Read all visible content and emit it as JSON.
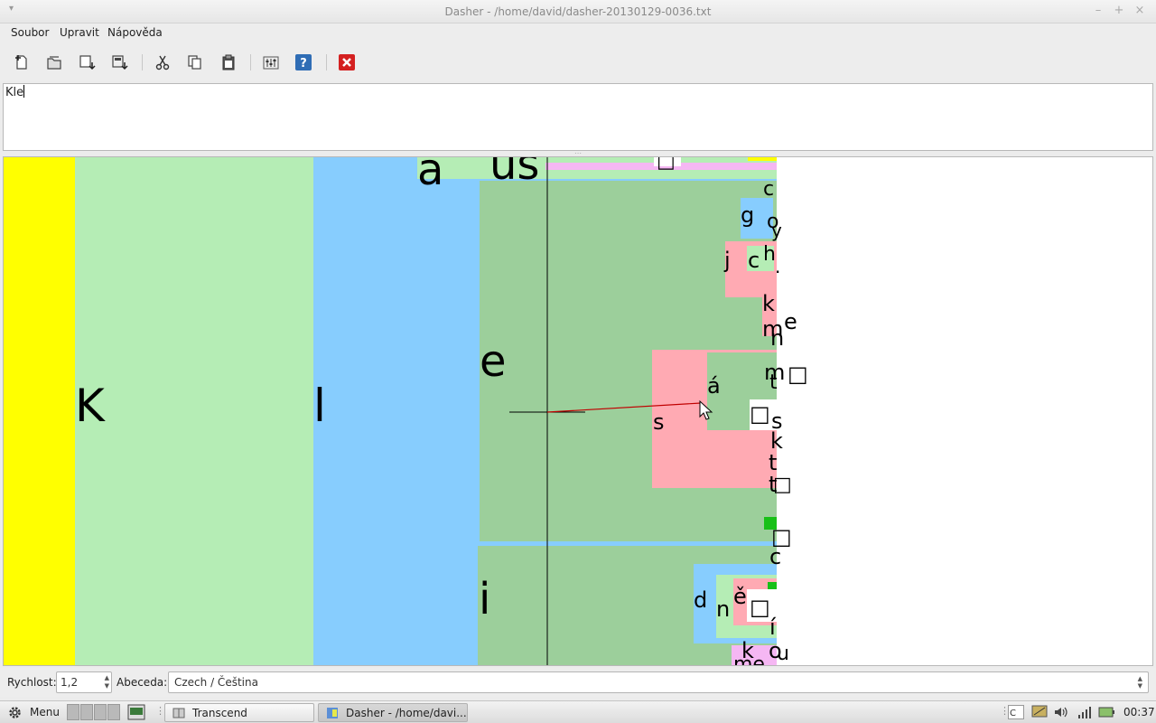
{
  "window": {
    "title": "Dasher - /home/david/dasher-20130129-0036.txt"
  },
  "menubar": {
    "items": [
      "Soubor",
      "Upravit",
      "Nápověda"
    ]
  },
  "toolbar": {
    "icons": [
      "new-file-icon",
      "open-file-icon",
      "save-file-icon",
      "save-as-icon",
      "cut-icon",
      "copy-icon",
      "paste-icon",
      "preferences-icon",
      "help-icon",
      "quit-icon"
    ],
    "help_glyph": "?",
    "colors": {
      "help_bg": "#2f6db5",
      "quit_bg": "#d42020"
    }
  },
  "editor": {
    "text": "Kle"
  },
  "canvas": {
    "colors": {
      "yellow": "#ffff00",
      "light_green": "#b5edb5",
      "light_blue": "#87cdfe",
      "mid_green": "#9ccf9b",
      "pink": "#ffaab3",
      "magenta_light": "#f5b7f3",
      "green_bright": "#18c018",
      "crosshair": "#000000",
      "pointer_line": "#c00000"
    },
    "letters": {
      "K": "K",
      "l": "l",
      "a": "a",
      "us": "us",
      "e": "e",
      "i": "i",
      "s": "s",
      "aacute": "á",
      "c1": "c",
      "g": "g",
      "o": "o",
      "y": "y",
      "j": "j",
      "c2": "c",
      "h": "h",
      "dot": ".",
      "k1": "k",
      "m1": "m",
      "e2": "e",
      "n1": "n",
      "m2": "m",
      "t1": "t",
      "s2": "s",
      "k2": "k",
      "t2": "t",
      "t3": "t",
      "c3": "c",
      "d": "d",
      "n2": "n",
      "ecaron": "ě",
      "iacute": "í",
      "k3": "k",
      "o2": "o",
      "u": "u",
      "me": "me",
      "space_symbol": "□"
    }
  },
  "statusbar": {
    "speed_label": "Rychlost:",
    "speed_value": "1,2",
    "alphabet_label": "Abeceda:",
    "alphabet_value": "Czech / Čeština"
  },
  "taskbar": {
    "menu_label": "Menu",
    "tasks": [
      "Transcend",
      "Dasher - /home/davi..."
    ],
    "clock": "00:37"
  }
}
